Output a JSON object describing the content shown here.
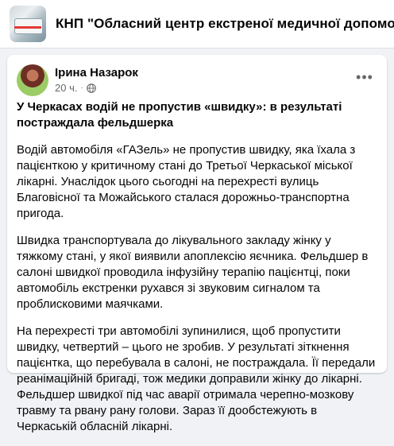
{
  "group": {
    "title": "КНП \"Обласний центр екстреної медичної допомоги та"
  },
  "post": {
    "author": "Ірина Назарок",
    "time": "20 ч.",
    "separator": "·",
    "more_label": "•••",
    "headline": "У Черкасах водій не пропустив «швидку»: в результаті постраждала фельдшерка",
    "paragraphs": [
      "Водій автомобіля «ГАЗель» не пропустив швидку, яка їхала з пацієнткою у критичному стані до Третьої Черкаської міської лікарні. Унаслідок цього сьогодні на перехресті вулиць Благовісної та Можайського сталася дорожньо-транспортна пригода.",
      "Швидка транспортувала до лікувального закладу жінку у тяжкому стані, у якої виявили апоплексію яєчника. Фельдшер в салоні швидкої проводила інфузійну терапію пацієнтці, поки автомобіль екстренки рухався зі звуковим сигналом та проблисковими маячками.",
      "На перехресті три автомобілі зупинилися, щоб пропустити швидку, четвертий – цього не зробив. У результаті зіткнення пацієнтка, що перебувала в салоні, не постраждала. Її передали реанімаційній бригаді, тож медики доправили жінку до лікарні. Фельдшер швидкої під час аварії отримала черепно-мозкову травму та рвану рану голови. Зараз її дообстежують в Черкаській обласній лікарні."
    ]
  },
  "icons": {
    "globe": "globe-icon",
    "more": "more-options-icon"
  }
}
